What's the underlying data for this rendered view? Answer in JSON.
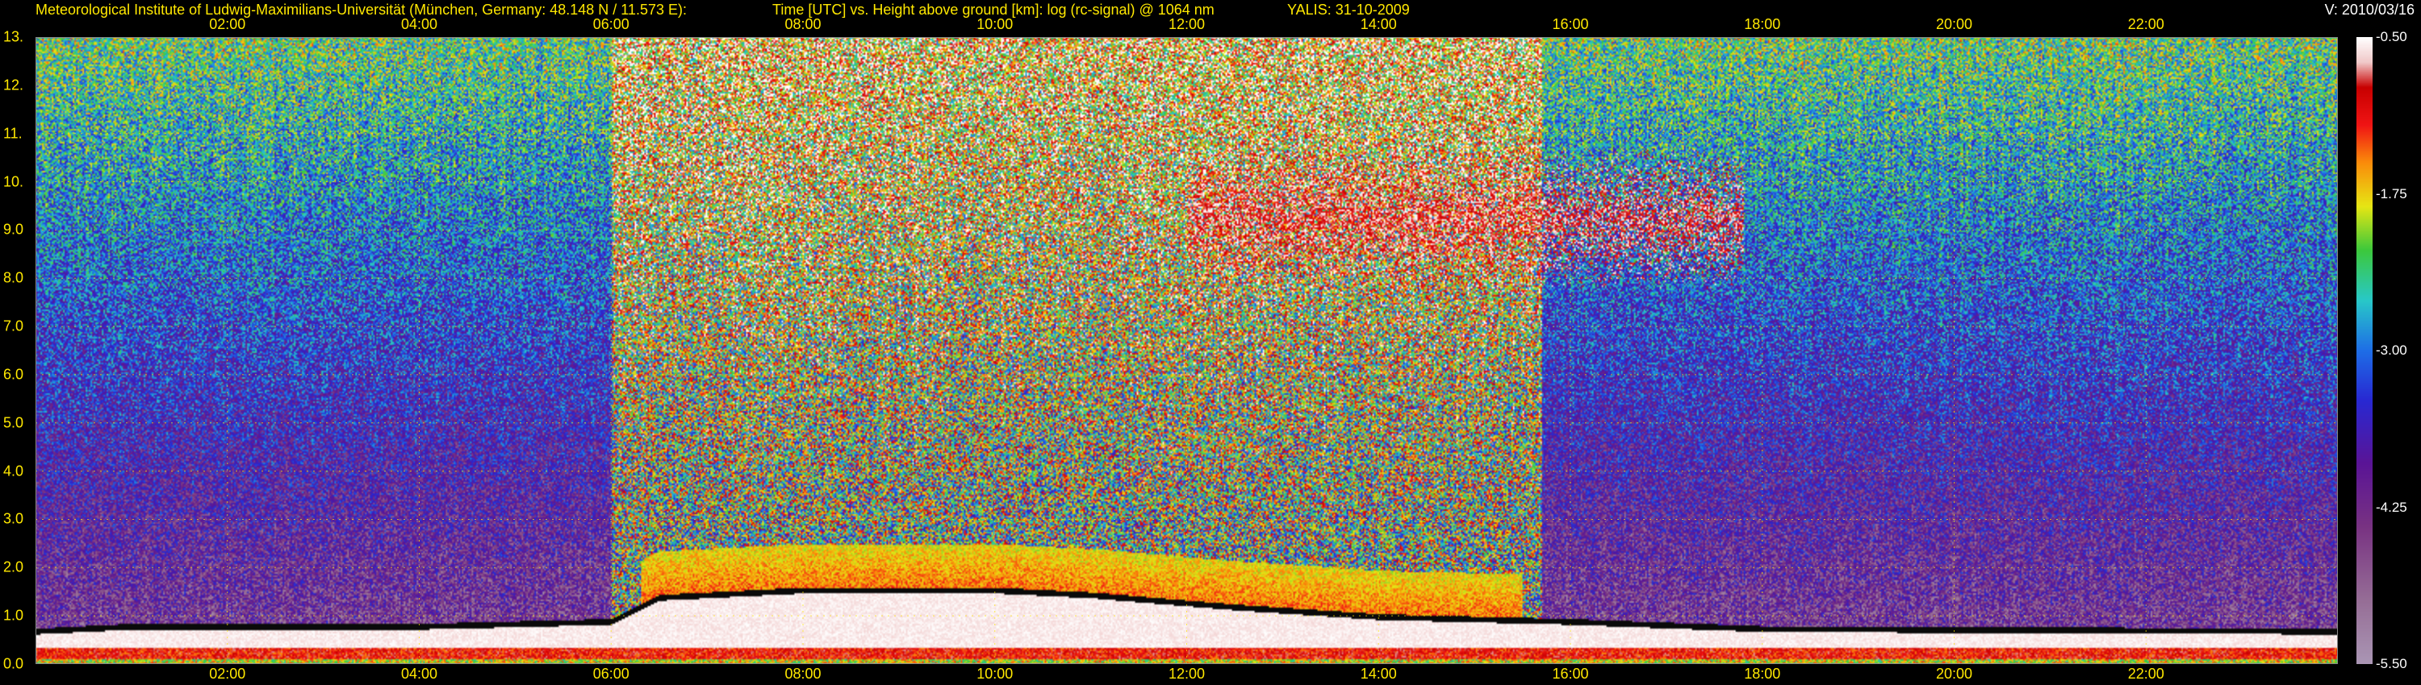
{
  "header": {
    "institute": "Meteorological Institute of Ludwig-Maximilians-Universität (München, Germany: 48.148 N / 11.573 E):",
    "axis_desc": "Time [UTC] vs. Height above ground [km]: log (rc-signal) @ 1064 nm",
    "instrument_date": "YALIS: 31-10-2009",
    "version": "V: 2010/03/16"
  },
  "colors": {
    "text": "#ffe800",
    "background": "#000000",
    "grid": "#ffe800"
  },
  "chart_data": {
    "type": "heatmap",
    "title": "Time [UTC] vs. Height above ground [km]: log (rc-signal) @ 1064 nm",
    "xlabel": "Time [UTC]",
    "ylabel": "Height above ground [km]",
    "x_range_hours": [
      0,
      24
    ],
    "ylim": [
      0.0,
      13.0
    ],
    "x_ticks": [
      "02:00",
      "04:00",
      "06:00",
      "08:00",
      "10:00",
      "12:00",
      "14:00",
      "16:00",
      "18:00",
      "20:00",
      "22:00"
    ],
    "x_tick_hours": [
      2,
      4,
      6,
      8,
      10,
      12,
      14,
      16,
      18,
      20,
      22
    ],
    "y_ticks": [
      "0.0",
      "1.0",
      "2.0",
      "3.0",
      "4.0",
      "5.0",
      "6.0",
      "7.0",
      "8.0",
      "9.0",
      "10.",
      "11.",
      "12.",
      "13."
    ],
    "y_tick_values": [
      0,
      1,
      2,
      3,
      4,
      5,
      6,
      7,
      8,
      9,
      10,
      11,
      12,
      13
    ],
    "grid": true,
    "colorbar": {
      "range": [
        -5.5,
        -0.5
      ],
      "ticks": [
        "-0.50",
        "-1.75",
        "-3.00",
        "-4.25",
        "-5.50"
      ],
      "tick_values": [
        -0.5,
        -1.75,
        -3.0,
        -4.25,
        -5.5
      ]
    },
    "features": {
      "boundary_layer_top_km": [
        [
          0.0,
          0.75
        ],
        [
          1.0,
          0.85
        ],
        [
          4.0,
          0.85
        ],
        [
          6.0,
          0.95
        ],
        [
          6.5,
          1.45
        ],
        [
          8.0,
          1.6
        ],
        [
          10.0,
          1.6
        ],
        [
          11.0,
          1.5
        ],
        [
          12.5,
          1.25
        ],
        [
          14.0,
          1.05
        ],
        [
          16.0,
          0.95
        ],
        [
          18.0,
          0.8
        ],
        [
          24.0,
          0.75
        ]
      ],
      "cirrus_layer": {
        "start_hour": 12.0,
        "end_hour": 17.8,
        "base_km": 7.5,
        "top_km": 11.0
      },
      "high_noise_period_hours": [
        6.0,
        15.7
      ]
    }
  }
}
